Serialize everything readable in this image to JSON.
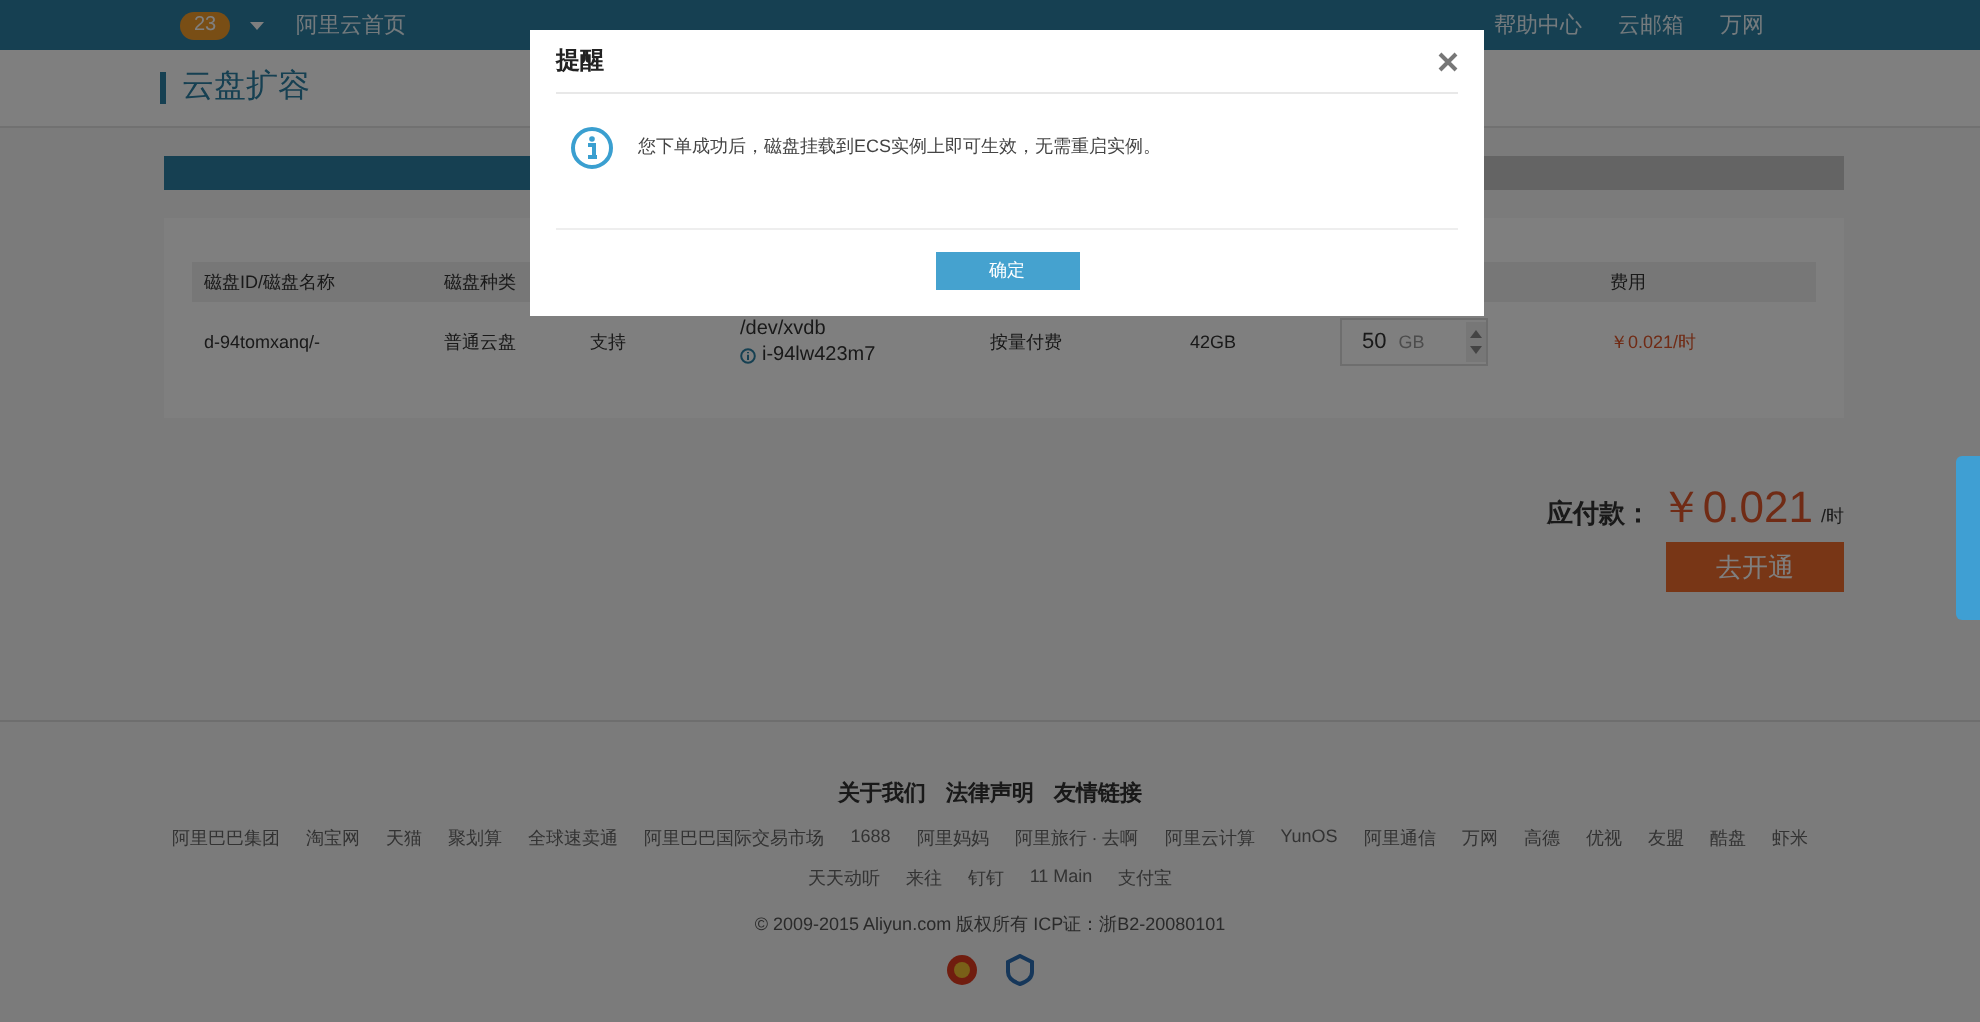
{
  "top_bar": {
    "message_count": "23",
    "left_links": [
      "阿里云首页"
    ],
    "right_links": [
      "帮助中心",
      "云邮箱",
      "万网"
    ]
  },
  "page_title": "云盘扩容",
  "steps": [
    {
      "selected": true
    },
    {
      "selected": false
    }
  ],
  "table": {
    "columns": [
      "磁盘ID/磁盘名称",
      "磁盘种类",
      "费用"
    ],
    "rows": [
      {
        "disk_id": "d-94tomxanq/-",
        "disk_type": "普通云盘",
        "column_3": "支持",
        "device": "/dev/xvdb",
        "instance": "i-94lw423m7",
        "billing": "按量付费",
        "current_size": "42GB",
        "new_size": "50",
        "unit": "GB",
        "cost": "￥0.021/时"
      }
    ]
  },
  "payment": {
    "label": "应付款：",
    "amount": "￥0.021",
    "unit": "/时",
    "button": "去开通"
  },
  "footer": {
    "primary_links": [
      "关于我们",
      "法律声明",
      "友情链接"
    ],
    "links": [
      "阿里巴巴集团",
      "淘宝网",
      "天猫",
      "聚划算",
      "全球速卖通",
      "阿里巴巴国际交易市场",
      "1688",
      "阿里妈妈",
      "阿里旅行 · 去啊",
      "阿里云计算",
      "YunOS",
      "阿里通信",
      "万网",
      "高德",
      "优视",
      "友盟",
      "酷盘",
      "虾米",
      "天天动听",
      "来往",
      "钉钉",
      "11 Main",
      "支付宝"
    ],
    "copyright": "© 2009-2015 Aliyun.com 版权所有 ICP证：浙B2-20080101"
  },
  "dialog": {
    "title": "提醒",
    "message": "您下单成功后，磁盘挂载到ECS实例上即可生效，无需重启实例。",
    "ok": "确定"
  }
}
